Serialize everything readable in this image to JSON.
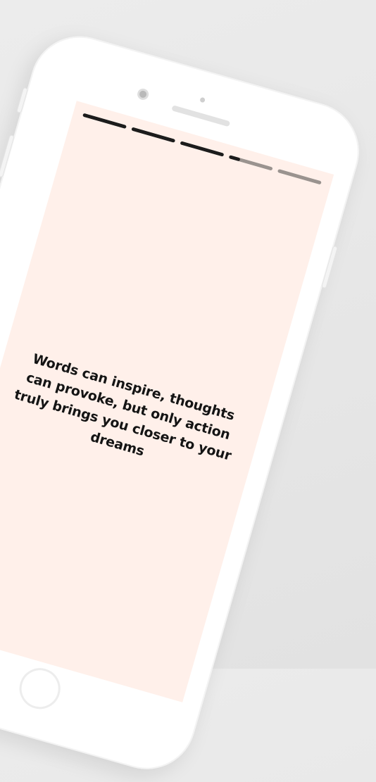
{
  "story": {
    "segments": [
      {
        "progress": 1.0
      },
      {
        "progress": 1.0
      },
      {
        "progress": 1.0
      },
      {
        "progress": 0.25
      },
      {
        "progress": 0.0
      }
    ],
    "quote": "Words can inspire, thoughts can provoke, but only action truly brings you closer to your dreams"
  },
  "colors": {
    "background": "#fff0ea",
    "segment_active": "#1c1c1c",
    "segment_inactive": "#9a938f",
    "text": "#141414"
  }
}
